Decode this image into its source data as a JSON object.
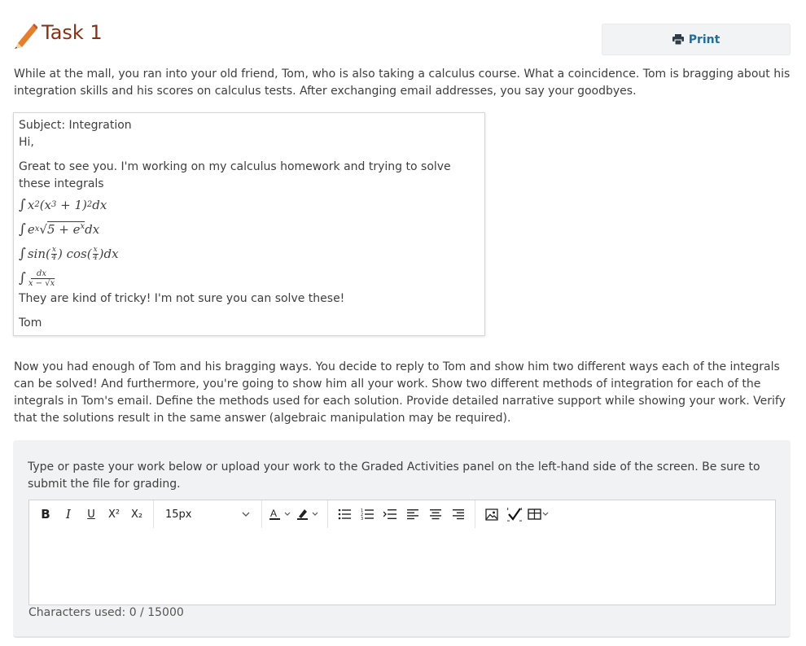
{
  "header": {
    "title": "Task 1",
    "print_label": "Print"
  },
  "intro": "While at the mall, you ran into your old friend, Tom, who is also taking a calculus course. What a coincidence. Tom is bragging about his integration skills and his scores on calculus tests. After exchanging email addresses, you say your goodbyes.",
  "email": {
    "subject": "Subject: Integration",
    "greeting": "Hi,",
    "body": "Great to see you. I'm working on my calculus homework and trying to solve these integrals",
    "closing": "They are kind of tricky! I'm not sure you can solve these!",
    "signature": "Tom"
  },
  "task": "Now you had enough of Tom and his bragging ways. You decide to reply to Tom and show him two different ways each of the integrals can be solved! And furthermore, you're going to show him all your work. Show two different methods of integration for each of the integrals in Tom's email. Define the methods used for each solution. Provide detailed narrative support while showing your work. Verify that the solutions result in the same answer (algebraic manipulation may be required).",
  "answer": {
    "instructions": "Type or paste your work below or upload your work to the Graded Activities panel on the left-hand side of the screen. Be sure to submit the file for grading.",
    "toolbar": {
      "bold": "B",
      "italic": "I",
      "underline": "U",
      "superscript": "X²",
      "subscript": "X₂",
      "font_size": "15px"
    },
    "char_count": "Characters used: 0 / 15000"
  },
  "colors": {
    "title": "#8b2e13",
    "print": "#1d6fa3",
    "panel": "#f1f2f3"
  }
}
